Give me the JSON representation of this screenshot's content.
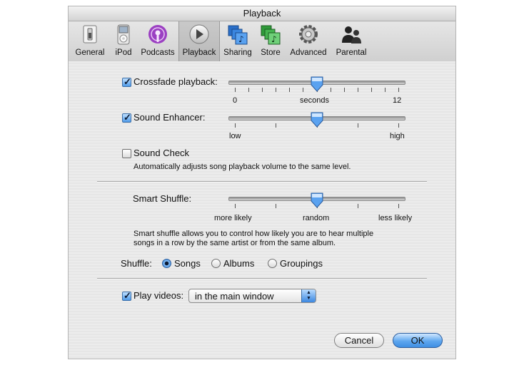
{
  "window": {
    "title": "Playback"
  },
  "toolbar": {
    "items": [
      {
        "label": "General",
        "icon": "general-switch-icon"
      },
      {
        "label": "iPod",
        "icon": "ipod-icon"
      },
      {
        "label": "Podcasts",
        "icon": "podcasts-icon"
      },
      {
        "label": "Playback",
        "icon": "playback-icon",
        "selected": true
      },
      {
        "label": "Sharing",
        "icon": "sharing-icon"
      },
      {
        "label": "Store",
        "icon": "store-icon"
      },
      {
        "label": "Advanced",
        "icon": "gear-icon"
      },
      {
        "label": "Parental",
        "icon": "parental-icon"
      }
    ]
  },
  "crossfade": {
    "label": "Crossfade playback:",
    "checked": true,
    "min_label": "0",
    "mid_label": "seconds",
    "max_label": "12",
    "value": 6,
    "min": 0,
    "max": 12
  },
  "enhancer": {
    "label": "Sound Enhancer:",
    "checked": true,
    "min_label": "low",
    "max_label": "high",
    "fraction": 0.5
  },
  "soundcheck": {
    "label": "Sound Check",
    "checked": false,
    "description": "Automatically adjusts song playback volume to the same level."
  },
  "smart_shuffle": {
    "label": "Smart Shuffle:",
    "min_label": "more likely",
    "mid_label": "random",
    "max_label": "less likely",
    "fraction": 0.5,
    "description_line1": "Smart shuffle allows you to control how likely you are to hear multiple",
    "description_line2": "songs in a row by the same artist or from the same album."
  },
  "shuffle": {
    "label": "Shuffle:",
    "options": [
      "Songs",
      "Albums",
      "Groupings"
    ],
    "selected": "Songs"
  },
  "videos": {
    "label": "Play videos:",
    "checked": true,
    "selected": "in the main window"
  },
  "buttons": {
    "cancel": "Cancel",
    "ok": "OK"
  },
  "colors": {
    "accent": "#3f8ee2",
    "window_bg": "#ececec"
  }
}
